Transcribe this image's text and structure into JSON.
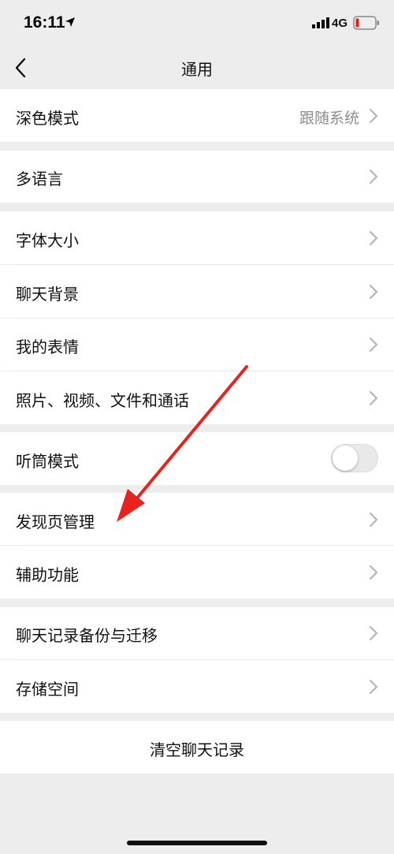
{
  "status": {
    "time": "16:11",
    "network": "4G",
    "battery_color": "#e02020"
  },
  "nav": {
    "title": "通用",
    "back_icon": "chevron-left-icon"
  },
  "settings": {
    "dark_mode": {
      "label": "深色模式",
      "value": "跟随系统"
    },
    "language": {
      "label": "多语言"
    },
    "font_size": {
      "label": "字体大小"
    },
    "chat_background": {
      "label": "聊天背景"
    },
    "my_stickers": {
      "label": "我的表情"
    },
    "media_files": {
      "label": "照片、视频、文件和通话"
    },
    "earpiece_mode": {
      "label": "听筒模式",
      "enabled": false
    },
    "discover_management": {
      "label": "发现页管理"
    },
    "accessibility": {
      "label": "辅助功能"
    },
    "chat_backup": {
      "label": "聊天记录备份与迁移"
    },
    "storage": {
      "label": "存储空间"
    },
    "clear_history": {
      "label": "清空聊天记录"
    }
  },
  "colors": {
    "background": "#ededed",
    "annotation_arrow": "#e8231f"
  }
}
